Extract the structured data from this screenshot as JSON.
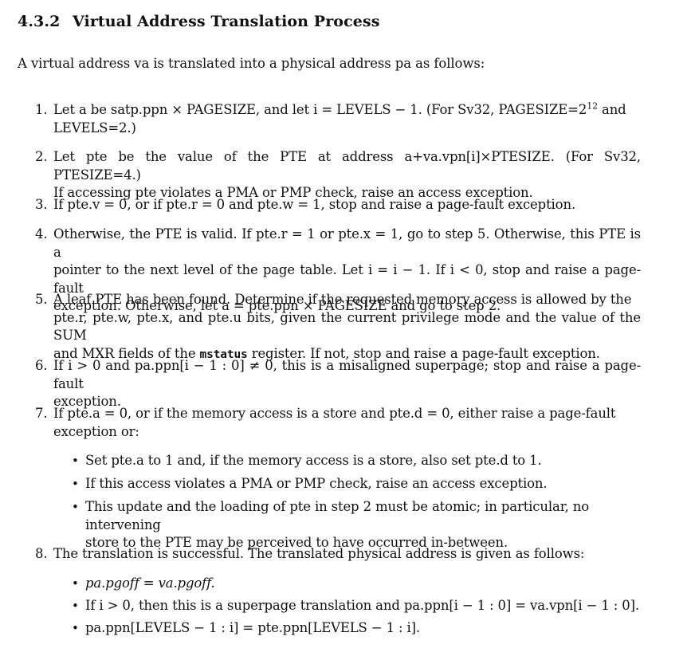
{
  "heading": {
    "number": "4.3.2",
    "title": "Virtual Address Translation Process"
  },
  "intro": "A virtual address va is translated into a physical address pa as follows:",
  "steps": [
    {
      "n": "1.",
      "l1": "Let a be satp.ppn × PAGESIZE, and let i = LEVELS − 1. (For Sv32, PAGESIZE=2",
      "l1sup": "12",
      "l1end": " and",
      "l2": "LEVELS=2.)"
    },
    {
      "n": "2.",
      "l1": "Let pte be the value of the PTE at address a+va.vpn[i]×PTESIZE. (For Sv32, PTESIZE=4.)",
      "l2": "If accessing pte violates a PMA or PMP check, raise an access exception."
    },
    {
      "n": "3.",
      "l1": "If pte.v = 0, or if pte.r = 0 and pte.w = 1, stop and raise a page-fault exception."
    },
    {
      "n": "4.",
      "l1": "Otherwise, the PTE is valid. If pte.r = 1 or pte.x = 1, go to step 5. Otherwise, this PTE is a",
      "l2": "pointer to the next level of the page table. Let i = i − 1. If i < 0, stop and raise a page-fault",
      "l3": "exception. Otherwise, let a = pte.ppn × PAGESIZE and go to step 2."
    },
    {
      "n": "5.",
      "l1": "A leaf PTE has been found. Determine if the requested memory access is allowed by the",
      "l2": "pte.r, pte.w, pte.x, and pte.u bits, given the current privilege mode and the value of the SUM",
      "l3a": "and MXR fields of the ",
      "l3code": "mstatus",
      "l3b": " register. If not, stop and raise a page-fault exception."
    },
    {
      "n": "6.",
      "l1": "If i > 0 and pa.ppn[i − 1 : 0] ≠ 0, this is a misaligned superpage; stop and raise a page-fault",
      "l2": "exception."
    },
    {
      "n": "7.",
      "l1": "If pte.a = 0, or if the memory access is a store and pte.d = 0, either raise a page-fault",
      "l2": "exception or:"
    },
    {
      "n": "8.",
      "l1": "The translation is successful. The translated physical address is given as follows:"
    }
  ],
  "step7_bullets": [
    {
      "l1": "Set pte.a to 1 and, if the memory access is a store, also set pte.d to 1."
    },
    {
      "l1": "If this access violates a PMA or PMP check, raise an access exception."
    },
    {
      "l1": "This update and the loading of pte in step 2 must be atomic; in particular, no intervening",
      "l2": "store to the PTE may be perceived to have occurred in-between."
    }
  ],
  "step8_bullets": [
    {
      "l1": "pa.pgoff = va.pgoff."
    },
    {
      "l1": "If i > 0, then this is a superpage translation and pa.ppn[i − 1 : 0] = va.vpn[i − 1 : 0]."
    },
    {
      "l1": "pa.ppn[LEVELS − 1 : i] = pte.ppn[LEVELS − 1 : i]."
    }
  ],
  "bullet_glyph": "•"
}
